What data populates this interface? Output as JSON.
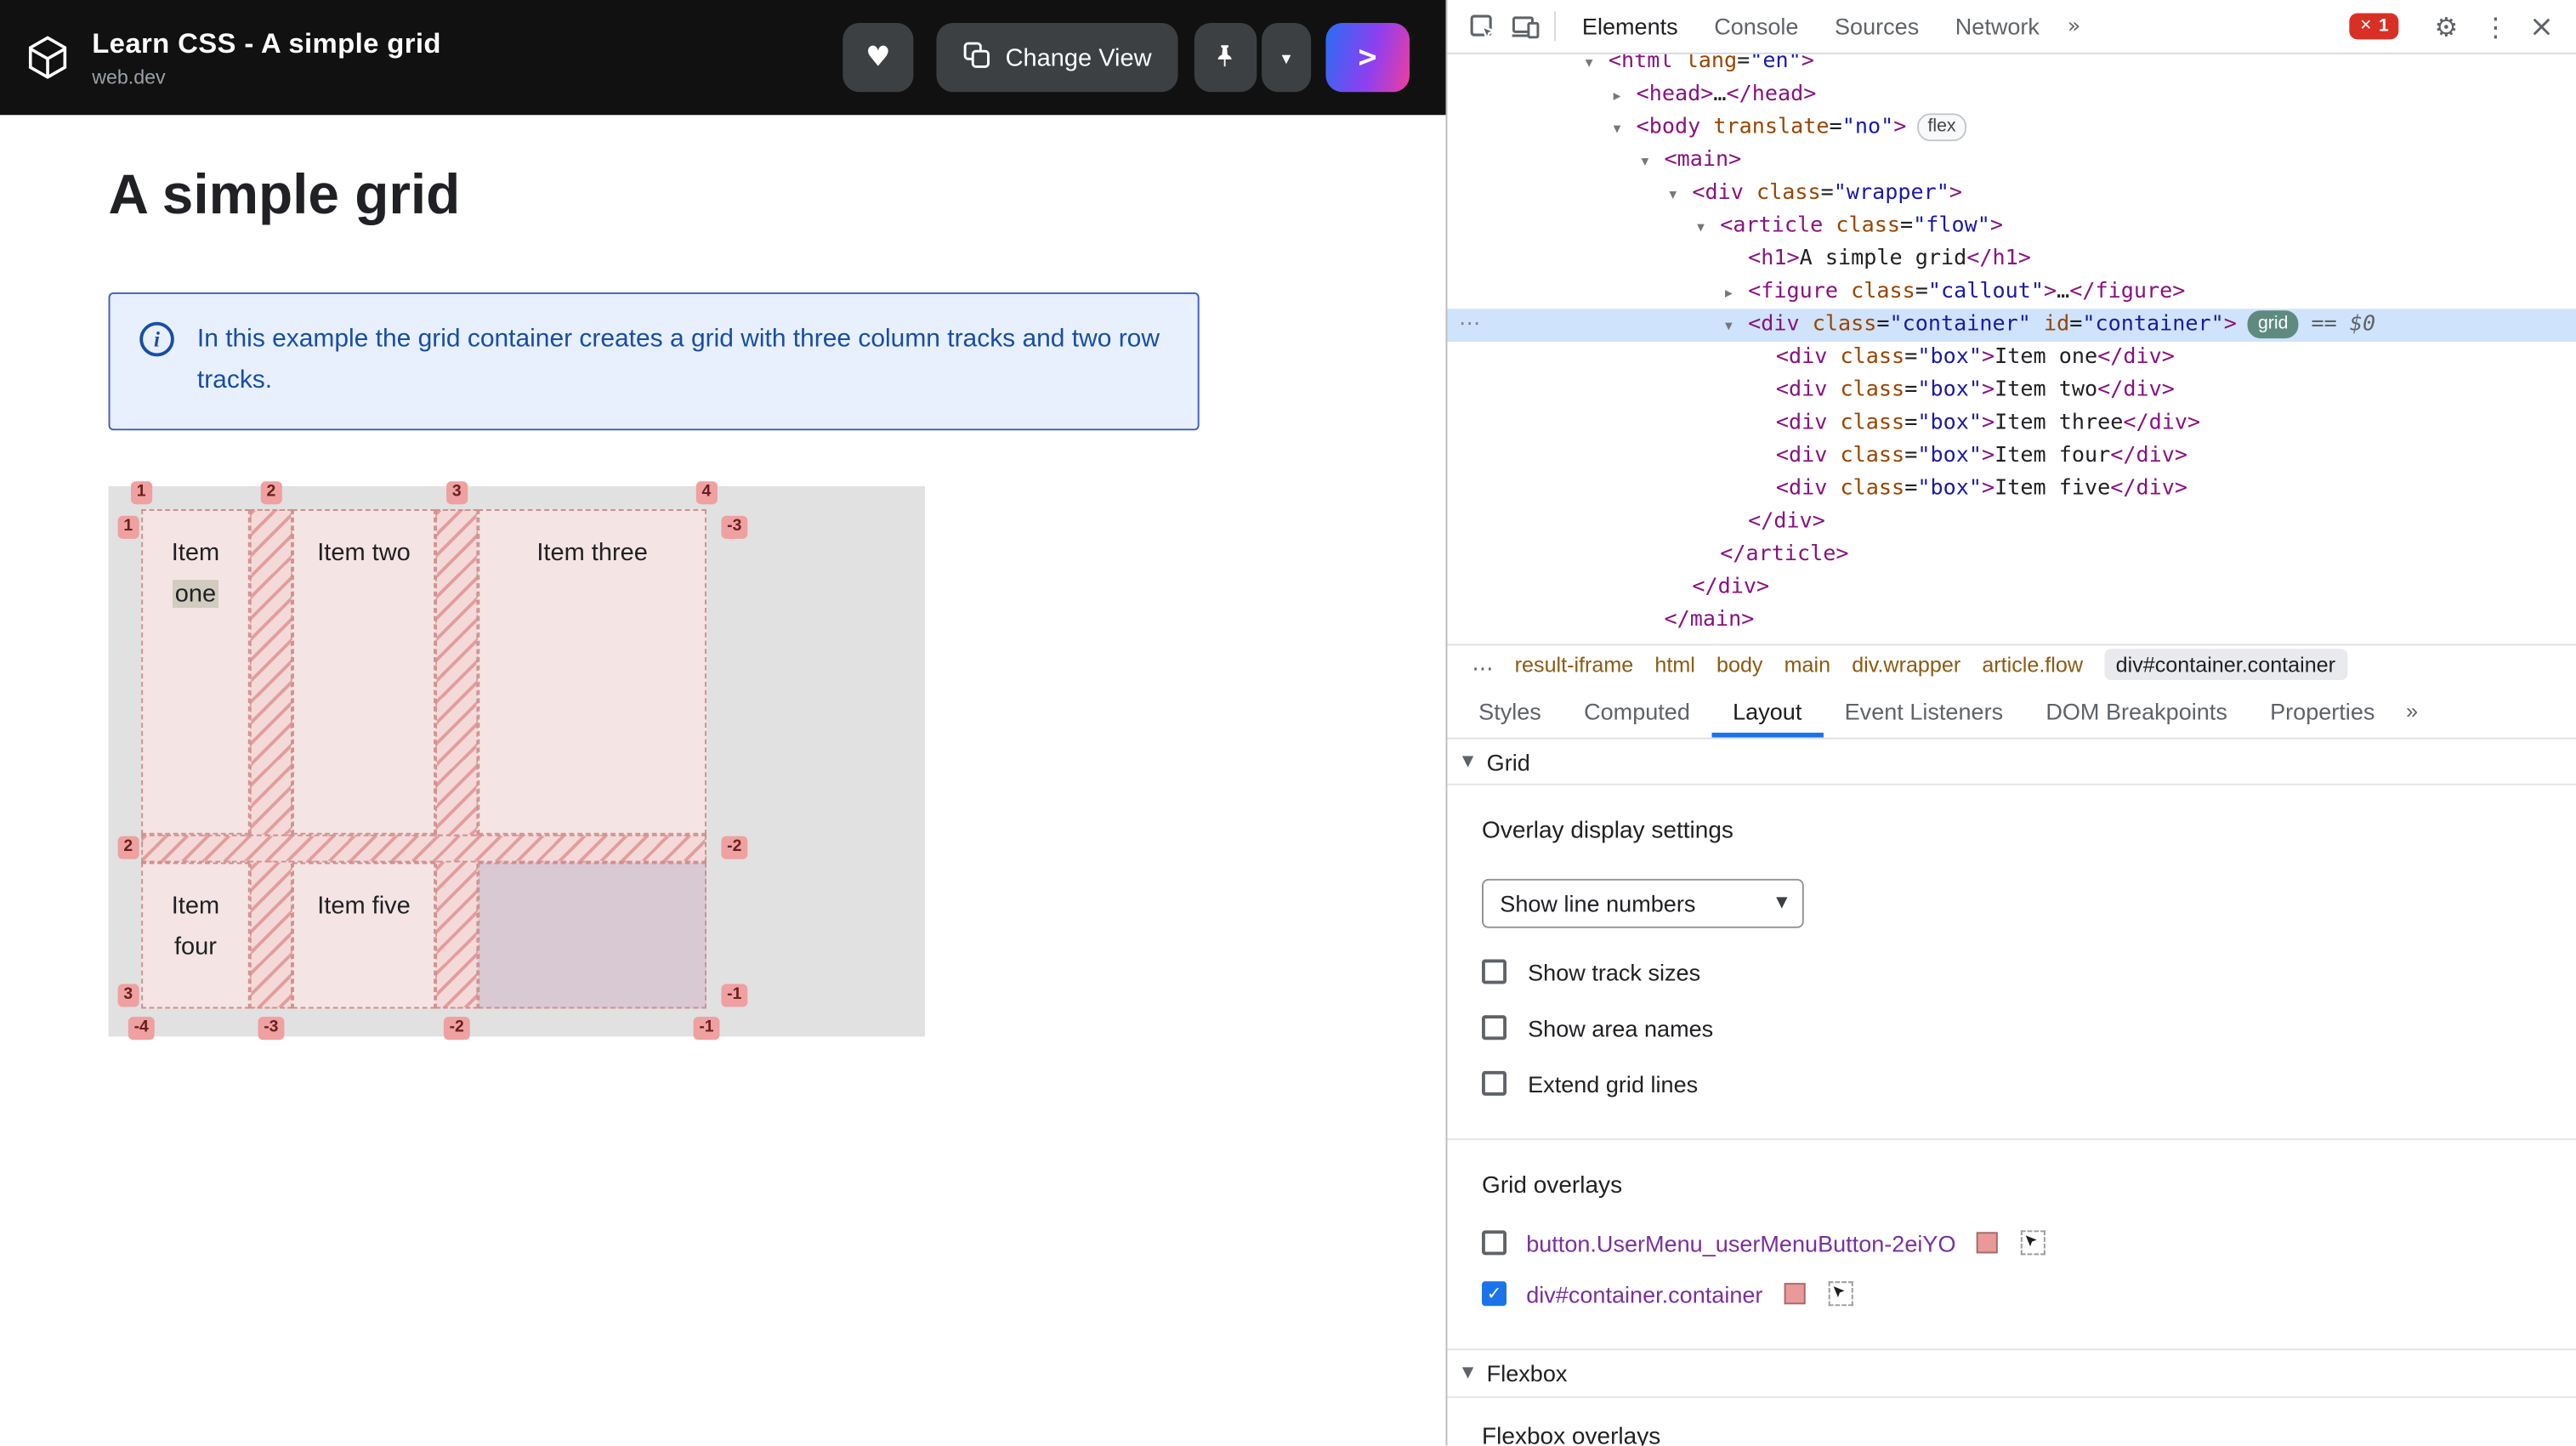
{
  "header": {
    "title": "Learn CSS - A simple grid",
    "subtitle": "web.dev",
    "change_view_label": "Change View"
  },
  "icons": {
    "heart": "♥",
    "chevron_down": "▾",
    "run": ">",
    "gear": "⚙",
    "kebab": "⋮",
    "close": "×",
    "more_tabs": "»",
    "crumb_ellipsis": "…",
    "info": "i",
    "selected_row_dots": "⋯",
    "error_x": "✕",
    "select_arrow": "▼",
    "section_arrow": "▼"
  },
  "page": {
    "heading": "A simple grid",
    "callout_text": "In this example the grid container creates a grid with three column tracks and two row tracks."
  },
  "grid_overlay": {
    "items": [
      {
        "label": "Item one",
        "row": 1,
        "col": 1,
        "highlight_word": "one"
      },
      {
        "label": "Item two",
        "row": 1,
        "col": 2
      },
      {
        "label": "Item three",
        "row": 1,
        "col": 3
      },
      {
        "label": "Item four",
        "row": 2,
        "col": 1
      },
      {
        "label": "Item five",
        "row": 2,
        "col": 2
      }
    ],
    "line_numbers": {
      "top": [
        "1",
        "2",
        "3",
        "4"
      ],
      "bottom": [
        "-4",
        "-3",
        "-2",
        "-1"
      ],
      "left": [
        "1",
        "2",
        "3"
      ],
      "right": [
        "-3",
        "-2",
        "-1"
      ]
    }
  },
  "devtools": {
    "toolbar": {
      "tabs": [
        {
          "label": "Elements",
          "active": true
        },
        {
          "label": "Console"
        },
        {
          "label": "Sources"
        },
        {
          "label": "Network"
        }
      ],
      "error_count": "1"
    },
    "tree": [
      {
        "indent": 0,
        "arrow": "open",
        "tokens": [
          [
            "t",
            "<html "
          ],
          [
            "a",
            "lang"
          ],
          [
            "x",
            "="
          ],
          [
            "v",
            "\"en\""
          ],
          [
            "t",
            ">"
          ]
        ]
      },
      {
        "indent": 1,
        "arrow": "closed",
        "tokens": [
          [
            "t",
            "<head>"
          ],
          [
            "x",
            "…"
          ],
          [
            "t",
            "</head>"
          ]
        ]
      },
      {
        "indent": 1,
        "arrow": "open",
        "tokens": [
          [
            "t",
            "<body "
          ],
          [
            "a",
            "translate"
          ],
          [
            "x",
            "="
          ],
          [
            "v",
            "\"no\""
          ],
          [
            "t",
            ">"
          ]
        ],
        "badges": [
          "flex"
        ]
      },
      {
        "indent": 2,
        "arrow": "open",
        "tokens": [
          [
            "t",
            "<main>"
          ]
        ]
      },
      {
        "indent": 3,
        "arrow": "open",
        "tokens": [
          [
            "t",
            "<div "
          ],
          [
            "a",
            "class"
          ],
          [
            "x",
            "="
          ],
          [
            "v",
            "\"wrapper\""
          ],
          [
            "t",
            ">"
          ]
        ]
      },
      {
        "indent": 4,
        "arrow": "open",
        "tokens": [
          [
            "t",
            "<article "
          ],
          [
            "a",
            "class"
          ],
          [
            "x",
            "="
          ],
          [
            "v",
            "\"flow\""
          ],
          [
            "t",
            ">"
          ]
        ]
      },
      {
        "indent": 5,
        "tokens": [
          [
            "t",
            "<h1>"
          ],
          [
            "x",
            "A simple grid"
          ],
          [
            "t",
            "</h1>"
          ]
        ]
      },
      {
        "indent": 5,
        "arrow": "closed",
        "tokens": [
          [
            "t",
            "<figure "
          ],
          [
            "a",
            "class"
          ],
          [
            "x",
            "="
          ],
          [
            "v",
            "\"callout\""
          ],
          [
            "t",
            ">"
          ],
          [
            "x",
            "…"
          ],
          [
            "t",
            "</figure>"
          ]
        ]
      },
      {
        "indent": 5,
        "arrow": "open",
        "selected": true,
        "tokens": [
          [
            "t",
            "<div "
          ],
          [
            "a",
            "class"
          ],
          [
            "x",
            "="
          ],
          [
            "v",
            "\"container\""
          ],
          [
            "a",
            " id"
          ],
          [
            "x",
            "="
          ],
          [
            "v",
            "\"container\""
          ],
          [
            "t",
            ">"
          ]
        ],
        "badges": [
          "grid"
        ],
        "suffix": "== $0"
      },
      {
        "indent": 6,
        "tokens": [
          [
            "t",
            "<div "
          ],
          [
            "a",
            "class"
          ],
          [
            "x",
            "="
          ],
          [
            "v",
            "\"box\""
          ],
          [
            "t",
            ">"
          ],
          [
            "x",
            "Item one"
          ],
          [
            "t",
            "</div>"
          ]
        ]
      },
      {
        "indent": 6,
        "tokens": [
          [
            "t",
            "<div "
          ],
          [
            "a",
            "class"
          ],
          [
            "x",
            "="
          ],
          [
            "v",
            "\"box\""
          ],
          [
            "t",
            ">"
          ],
          [
            "x",
            "Item two"
          ],
          [
            "t",
            "</div>"
          ]
        ]
      },
      {
        "indent": 6,
        "tokens": [
          [
            "t",
            "<div "
          ],
          [
            "a",
            "class"
          ],
          [
            "x",
            "="
          ],
          [
            "v",
            "\"box\""
          ],
          [
            "t",
            ">"
          ],
          [
            "x",
            "Item three"
          ],
          [
            "t",
            "</div>"
          ]
        ]
      },
      {
        "indent": 6,
        "tokens": [
          [
            "t",
            "<div "
          ],
          [
            "a",
            "class"
          ],
          [
            "x",
            "="
          ],
          [
            "v",
            "\"box\""
          ],
          [
            "t",
            ">"
          ],
          [
            "x",
            "Item four"
          ],
          [
            "t",
            "</div>"
          ]
        ]
      },
      {
        "indent": 6,
        "tokens": [
          [
            "t",
            "<div "
          ],
          [
            "a",
            "class"
          ],
          [
            "x",
            "="
          ],
          [
            "v",
            "\"box\""
          ],
          [
            "t",
            ">"
          ],
          [
            "x",
            "Item five"
          ],
          [
            "t",
            "</div>"
          ]
        ]
      },
      {
        "indent": 5,
        "tokens": [
          [
            "t",
            "</div>"
          ]
        ]
      },
      {
        "indent": 4,
        "tokens": [
          [
            "t",
            "</article>"
          ]
        ]
      },
      {
        "indent": 3,
        "tokens": [
          [
            "t",
            "</div>"
          ]
        ]
      },
      {
        "indent": 2,
        "tokens": [
          [
            "t",
            "</main>"
          ]
        ]
      }
    ],
    "breadcrumbs": [
      {
        "label": "result-iframe"
      },
      {
        "label": "html"
      },
      {
        "label": "body"
      },
      {
        "label": "main"
      },
      {
        "label": "div.wrapper"
      },
      {
        "label": "article.flow"
      },
      {
        "label": "div#container.container",
        "selected": true
      }
    ],
    "panel_tabs": [
      {
        "label": "Styles"
      },
      {
        "label": "Computed"
      },
      {
        "label": "Layout",
        "active": true
      },
      {
        "label": "Event Listeners"
      },
      {
        "label": "DOM Breakpoints"
      },
      {
        "label": "Properties"
      },
      {
        "label": "»",
        "overflow": true
      }
    ],
    "layout_pane": {
      "grid_section_label": "Grid",
      "overlay_settings_title": "Overlay display settings",
      "line_numbers_dropdown_value": "Show line numbers",
      "display_options": [
        {
          "label": "Show track sizes",
          "checked": false
        },
        {
          "label": "Show area names",
          "checked": false
        },
        {
          "label": "Extend grid lines",
          "checked": false
        }
      ],
      "grid_overlays_title": "Grid overlays",
      "grid_overlays": [
        {
          "label": "button.UserMenu_userMenuButton-2eiYO",
          "checked": false,
          "color": "#ea9999"
        },
        {
          "label": "div#container.container",
          "checked": true,
          "color": "#ea9999"
        }
      ],
      "flexbox_section_label": "Flexbox",
      "flexbox_overlays_title": "Flexbox overlays"
    }
  },
  "colors": {
    "accent_blue": "#1a73e8",
    "overlay_pink": "#ea9999",
    "error_red": "#d93025"
  }
}
